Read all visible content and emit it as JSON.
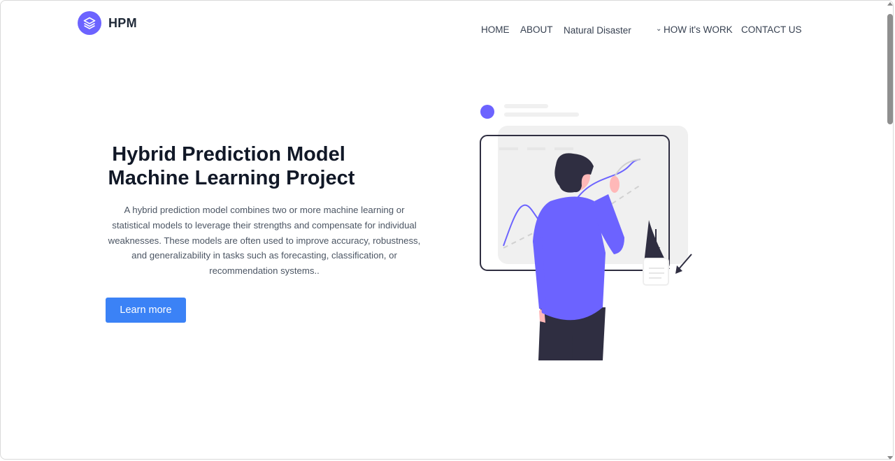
{
  "brand": {
    "name": "HPM",
    "icon": "layers-icon"
  },
  "nav": {
    "items": [
      {
        "label": "HOME"
      },
      {
        "label": "ABOUT"
      },
      {
        "label": "Natural Disaster"
      },
      {
        "label": "HOW it's WORK",
        "icon": "chevron-down-icon"
      },
      {
        "label": "CONTACT US"
      }
    ]
  },
  "hero": {
    "title_line1": "Hybrid Prediction Model",
    "title_line2": "Machine Learning Project",
    "description": "A hybrid prediction model combines two or more machine learning or statistical models to leverage their strengths and compensate for individual weaknesses. These models are often used to improve accuracy, robustness, and generalizability in tasks such as forecasting, classification, or recommendation systems..",
    "button_label": "Learn more"
  },
  "colors": {
    "accent": "#6c63ff",
    "button": "#3b82f6",
    "dark": "#2f2e41"
  }
}
